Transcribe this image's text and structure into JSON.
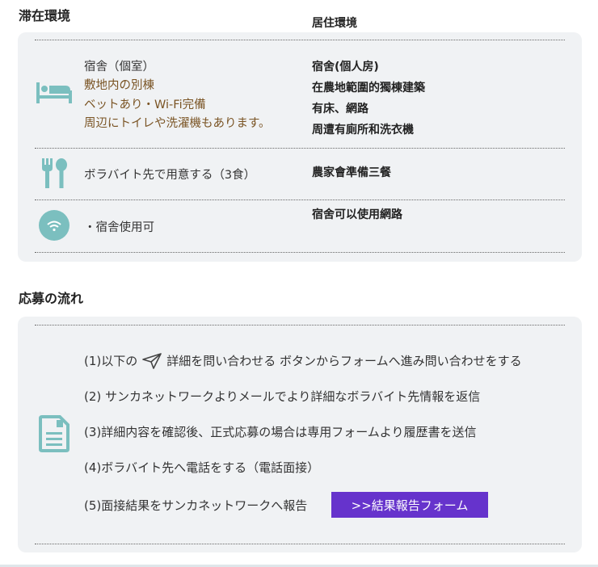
{
  "stay": {
    "title": "滞在環境",
    "translation_title": "居住環境",
    "rows": [
      {
        "icon": "bed-icon",
        "lines": [
          "宿舎（個室）",
          "敷地内の別棟",
          "ベットあり・Wi-Fi完備",
          "周辺にトイレや洗濯機もあります。"
        ],
        "translation": [
          "宿舍(個人房)",
          "在農地範圍的獨棟建築",
          "有床、網路",
          "周遭有廁所和洗衣機"
        ]
      },
      {
        "icon": "fork-spoon-icon",
        "lines": [
          "ボラバイト先で用意する（3食）"
        ],
        "translation": [
          "農家會準備三餐"
        ]
      },
      {
        "icon": "wifi-icon",
        "lines": [
          "・宿舎使用可"
        ],
        "translation": [
          "宿舍可以使用網路"
        ]
      }
    ]
  },
  "apply": {
    "title": "応募の流れ",
    "icon": "document-icon",
    "steps": [
      {
        "before": "(1)以下の",
        "icon": "paper-plane-icon",
        "after": "詳細を問い合わせる ボタンからフォームへ進み問い合わせをする"
      },
      {
        "text": "(2) サンカネットワークよりメールでより詳細なボラバイト先情報を返信"
      },
      {
        "text": "(3)詳細内容を確認後、正式応募の場合は専用フォームより履歴書を送信"
      },
      {
        "text": "(4)ボラバイト先へ電話をする（電話面接）"
      },
      {
        "text": "(5)面接結果をサンカネットワークへ報告"
      }
    ],
    "report_button": ">>結果報告フォーム"
  },
  "colors": {
    "accent": "#6633cc",
    "icon": "#7bbfbf",
    "panel": "#f0f2f4",
    "brown": "#7a5424"
  }
}
